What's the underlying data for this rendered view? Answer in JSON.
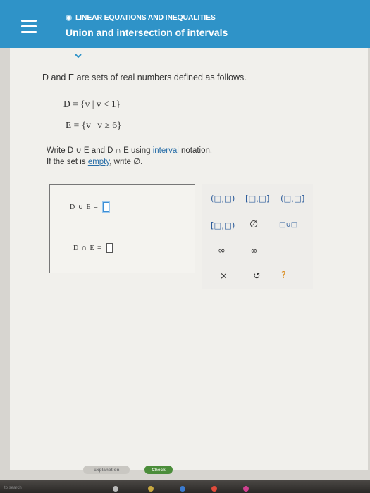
{
  "header": {
    "menu_icon": "hamburger-menu-icon",
    "topic": "LINEAR EQUATIONS AND INEQUALITIES",
    "title": "Union and intersection of intervals"
  },
  "problem": {
    "intro": "D and E are sets of real numbers defined as follows.",
    "set_d": "D = {v | v < 1}",
    "set_e": "E = {v | v ≥ 6}",
    "instruction_parts": [
      "Write D ∪ E and D ∩ E using ",
      "interval",
      " notation."
    ],
    "empty_parts": [
      "If the set is ",
      "empty",
      ", write ∅."
    ]
  },
  "answers": {
    "union_label": "D ∪ E =",
    "intersection_label": "D ∩ E ="
  },
  "keypad": {
    "open_open": "(□,□)",
    "closed_closed": "[□,□]",
    "open_closed": "(□,□]",
    "closed_open": "[□,□)",
    "empty_set": "∅",
    "union": "□∪□",
    "infinity": "∞",
    "neg_infinity": "-∞",
    "clear": "×",
    "undo": "↺",
    "help": "?"
  },
  "buttons": {
    "explanation": "Explanation",
    "check": "Check"
  },
  "taskbar": {
    "search": "to search"
  }
}
